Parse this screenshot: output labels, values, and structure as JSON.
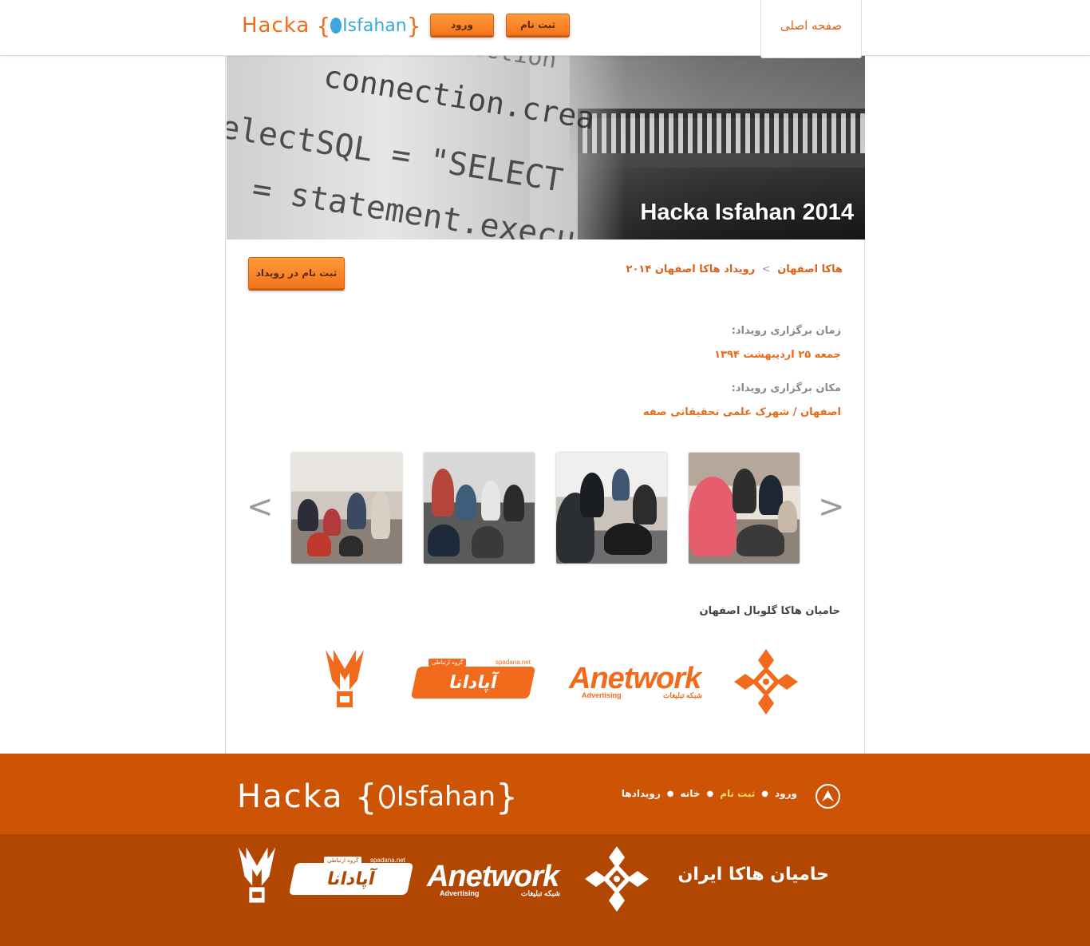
{
  "header": {
    "logo": {
      "hacka": "Hacka",
      "open_brace": "{",
      "isfahan": "Isfahan",
      "close_brace": "}"
    },
    "login_label": "ورود",
    "register_label": "ثبت نام",
    "home_tab_label": "صفحه اصلی",
    "brand_orange": "#f26a1b",
    "brand_blue": "#3aa7e0"
  },
  "banner": {
    "title": "Hacka Isfahan 2014",
    "code_lines": [
      "setConnection",
      "connection.crea",
      "electSQL = \"SELECT",
      "= statement.execu"
    ]
  },
  "breadcrumb": {
    "root": "هاکا اصفهان",
    "separator": ">",
    "current": "رویداد هاکا اصفهان ۲۰۱۴"
  },
  "event": {
    "register_button": "ثبت نام در رویداد",
    "time_label": "زمان برگزاری رویداد:",
    "time_value": "جمعه ۲۵ اردیبهشت ۱۳۹۴",
    "place_label": "مکان برگزاری رویداد:",
    "place_value": "اصفهان / شهرک علمی تحقیقاتی صفه"
  },
  "gallery": {
    "prev": "<",
    "next": ">",
    "photos": [
      "event-photo-1",
      "event-photo-2",
      "event-photo-3",
      "event-photo-4"
    ]
  },
  "sponsors": {
    "title": "حامیان هاکا گلوبال اصفهان",
    "anetwork": {
      "main": "Anetwork",
      "sub_en": "Advertising",
      "sub_fa": "شبکه تبلیغات"
    },
    "apadana": {
      "name": "آپادانا",
      "domain": "spadana.net",
      "tagline": "گروه ارتباطی"
    }
  },
  "footer": {
    "logo": {
      "hacka": "Hacka",
      "open_brace": "{",
      "isfahan": "Isfahan",
      "close_brace": "}"
    },
    "nav": [
      {
        "label": "ورود",
        "active": false
      },
      {
        "label": "ثبت نام",
        "active": true
      },
      {
        "label": "خانه",
        "active": false
      },
      {
        "label": "رویدادها",
        "active": false
      }
    ],
    "iran_sponsors_title": "حامیان هاکا ایران",
    "top_color": "#cc5404",
    "bottom_color": "#b14701",
    "active_nav_color": "#ffd95a"
  }
}
